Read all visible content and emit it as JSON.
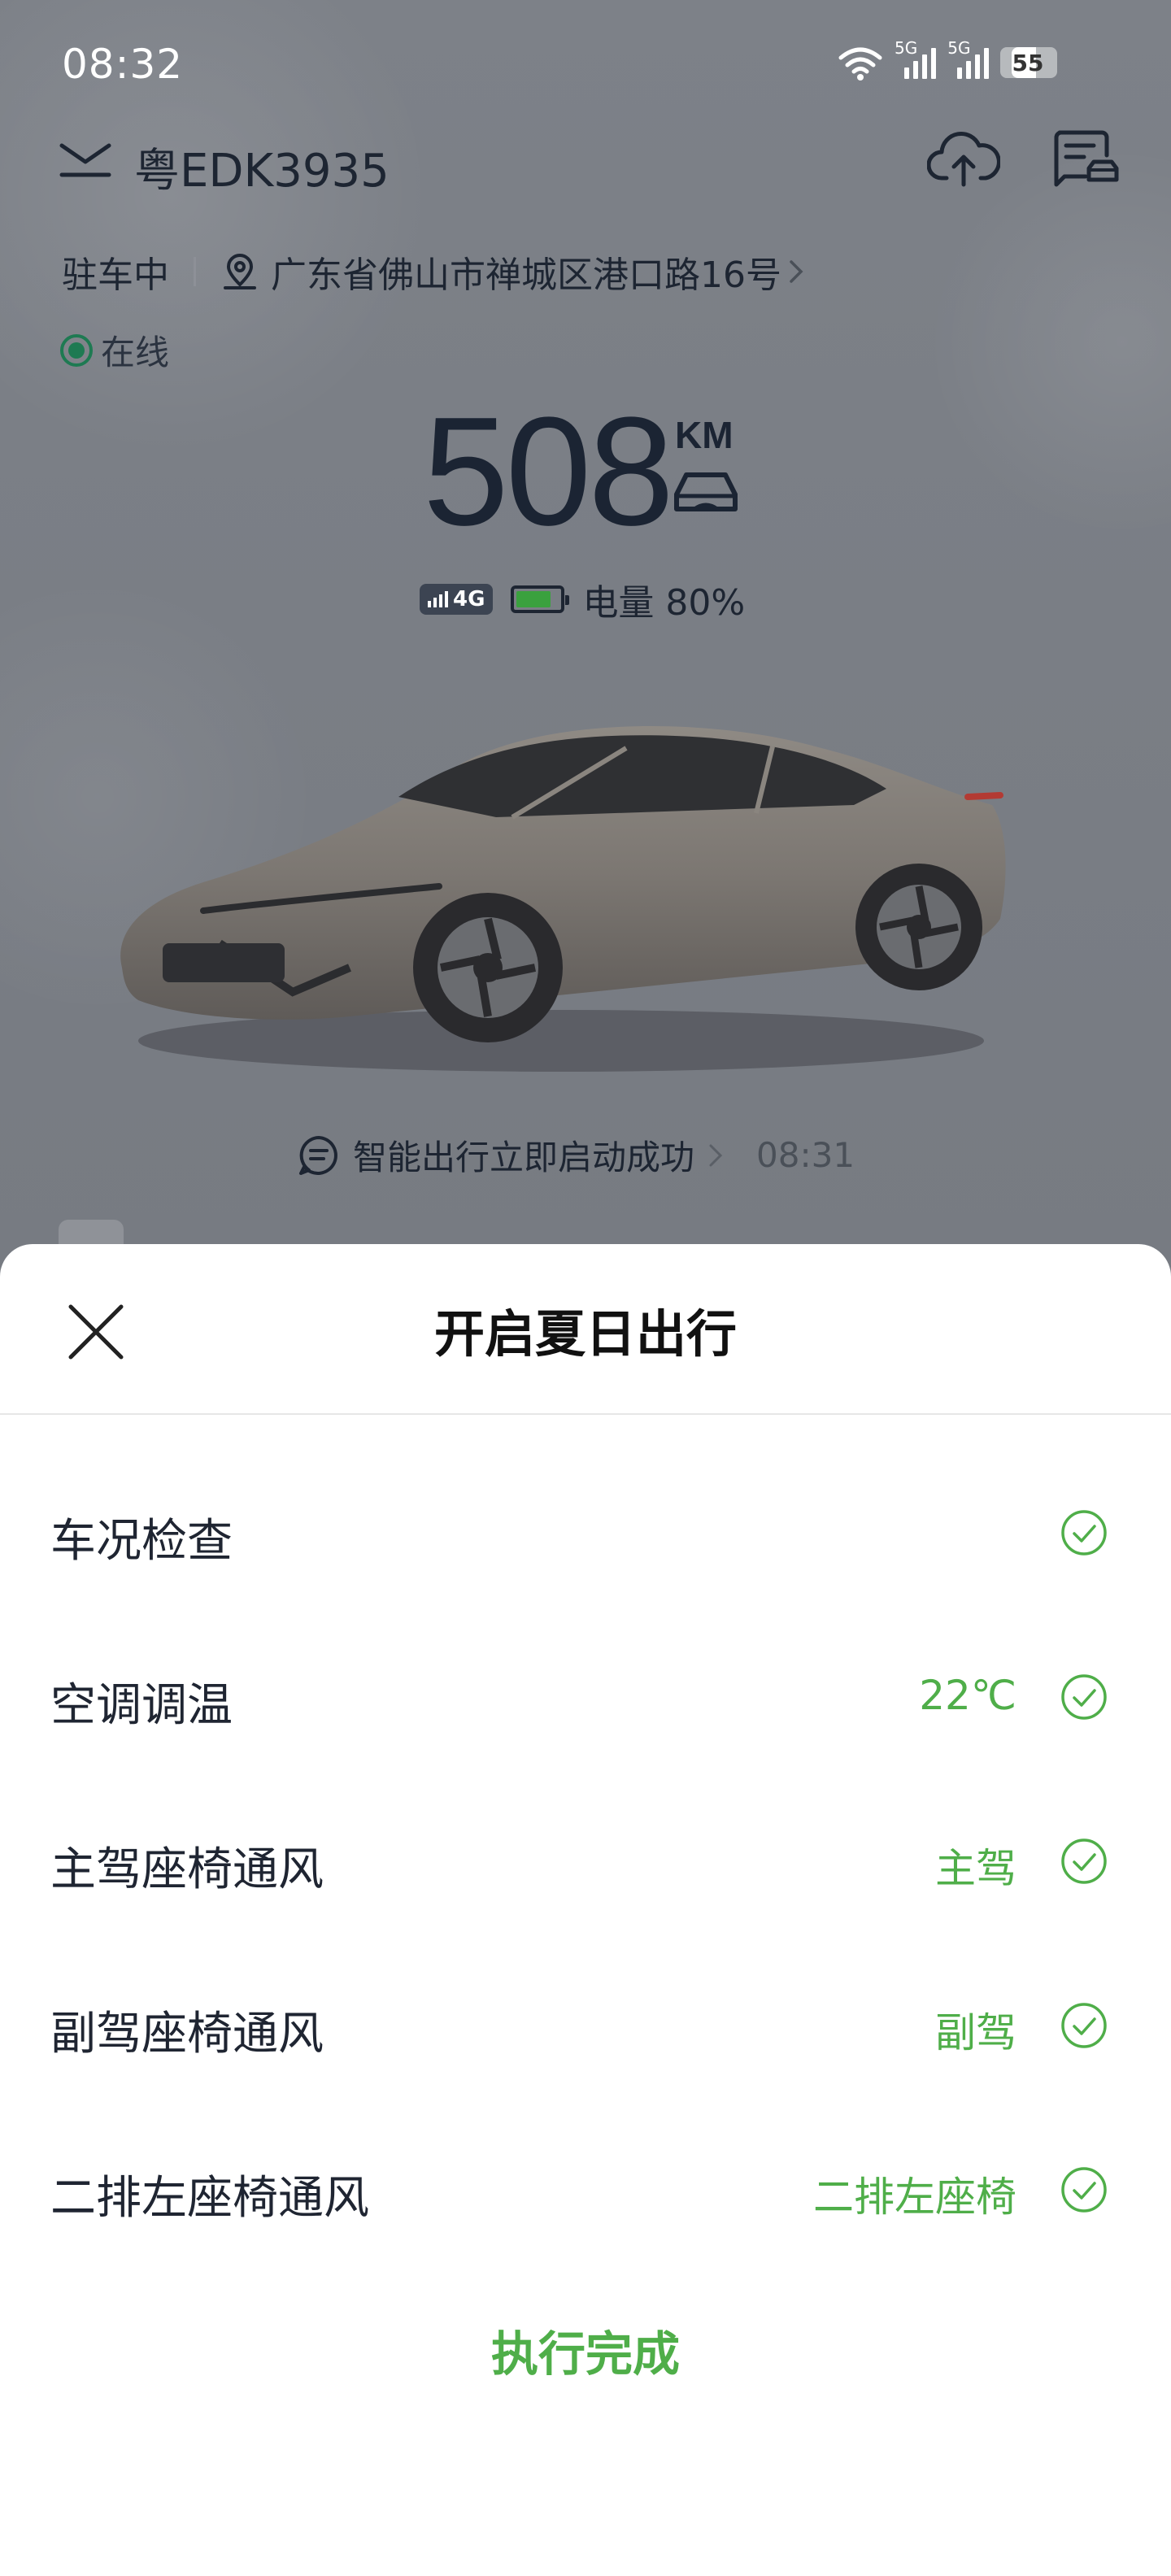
{
  "status_bar": {
    "time": "08:32",
    "network_1": "5G",
    "network_2": "5G",
    "battery_level": "55"
  },
  "header": {
    "plate": "粤EDK3935",
    "parking_status": "驻车中",
    "address": "广东省佛山市禅城区港口路16号",
    "online_label": "在线"
  },
  "vehicle": {
    "range_value": "508",
    "range_unit": "KM",
    "network_badge": "4G",
    "battery_text": "电量 80%",
    "battery_fraction": 0.8
  },
  "notice": {
    "text": "智能出行立即启动成功",
    "time": "08:31"
  },
  "sheet": {
    "title": "开启夏日出行",
    "items": [
      {
        "label": "车况检查",
        "value": ""
      },
      {
        "label": "空调调温",
        "value": "22℃"
      },
      {
        "label": "主驾座椅通风",
        "value": "主驾"
      },
      {
        "label": "副驾座椅通风",
        "value": "副驾"
      },
      {
        "label": "二排左座椅通风",
        "value": "二排左座椅"
      }
    ],
    "status": "执行完成"
  },
  "colors": {
    "accent_green": "#4fae49",
    "online_green": "#1e7a52",
    "text_dark": "#1d2532"
  }
}
